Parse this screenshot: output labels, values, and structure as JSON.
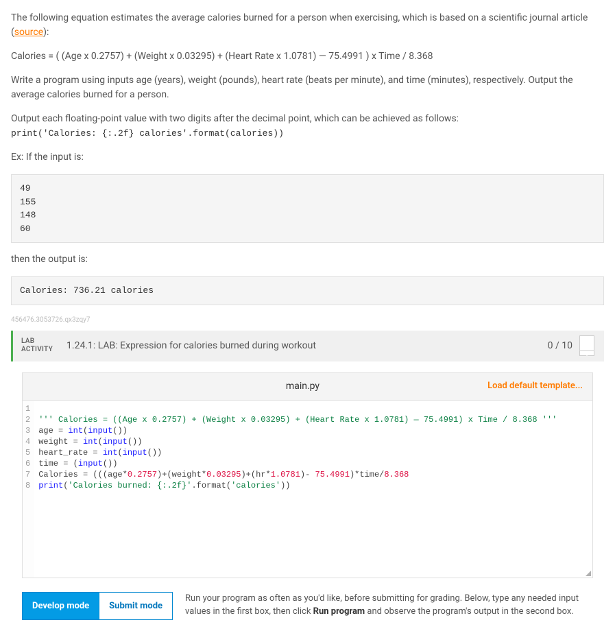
{
  "instructions": {
    "intro_prefix": "The following equation estimates the average calories burned for a person when exercising, which is based on a scientific journal article (",
    "source_link": "source",
    "intro_suffix": "):",
    "equation": "Calories = ( (Age x 0.2757) + (Weight x 0.03295) + (Heart Rate x 1.0781) — 75.4991 ) x Time / 8.368",
    "task": "Write a program using inputs age (years), weight (pounds), heart rate (beats per minute), and time (minutes), respectively. Output the average calories burned for a person.",
    "output_hint": "Output each floating-point value with two digits after the decimal point, which can be achieved as follows:",
    "output_code": "print('Calories: {:.2f} calories'.format(calories))",
    "ex_label": "Ex: If the input is:",
    "ex_input": "49\n155\n148\n60",
    "ex_output_label": "then the output is:",
    "ex_output": "Calories: 736.21 calories"
  },
  "tiny_id": "456476.3053726.qx3zqy7",
  "lab": {
    "label_line1": "LAB",
    "label_line2": "ACTIVITY",
    "title": "1.24.1: LAB: Expression for calories burned during workout",
    "score": "0 / 10"
  },
  "editor": {
    "filename": "main.py",
    "template_link": "Load default template...",
    "gutter": [
      "1",
      "2",
      "3",
      "4",
      "5",
      "6",
      "7",
      "8"
    ],
    "lines": [
      {
        "str": "''' Calories = ((Age x 0.2757) + (Weight x 0.03295) + (Heart Rate x 1.0781) — 75.4991) x Time / 8.368 '''"
      },
      {
        "plain": "age = ",
        "fn": "int",
        "paren": "(",
        "fn2": "input",
        "rest": "())"
      },
      {
        "plain": "weight = ",
        "fn": "int",
        "paren": "(",
        "fn2": "input",
        "rest": "())"
      },
      {
        "plain": "heart_rate = ",
        "fn": "int",
        "paren": "(",
        "fn2": "input",
        "rest": "())"
      },
      {
        "plain": "time = (",
        "fn2": "input",
        "rest": "())"
      },
      {
        "plain": "Calories = (((age*",
        "n1": "0.2757",
        "mid1": ")+(weight*",
        "n2": "0.03295",
        "mid2": ")+(hr*",
        "n3": "1.0781",
        "mid3": ")- ",
        "n4": "75.4991",
        "mid4": ")*time/",
        "n5": "8.368"
      },
      {
        "fn": "print",
        "open": "(",
        "s1": "'Calories burned: {:.2f}'",
        "mid": ".format(",
        "s2": "'calories'",
        "close": "))"
      },
      {
        "plain": ""
      }
    ]
  },
  "run": {
    "develop": "Develop mode",
    "submit": "Submit mode",
    "text_prefix": "Run your program as often as you'd like, before submitting for grading. Below, type any needed input values in the first box, then click ",
    "text_bold": "Run program",
    "text_suffix": " and observe the program's output in the second box."
  }
}
